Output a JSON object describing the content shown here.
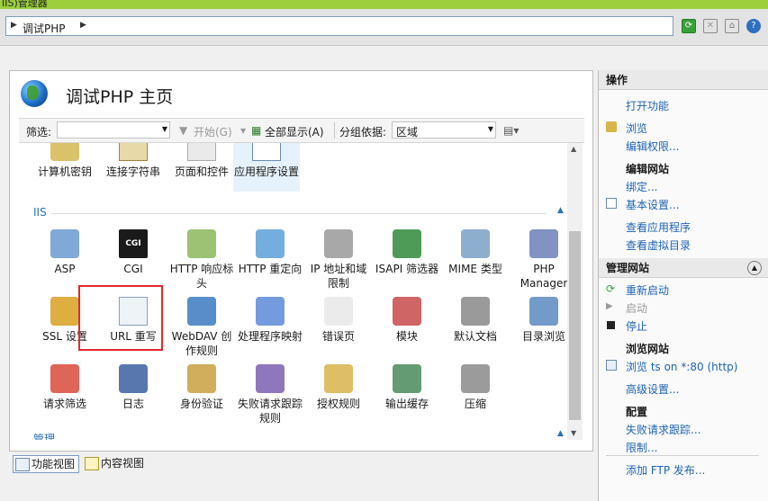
{
  "window": {
    "title": "IIS)管理器"
  },
  "address": {
    "crumb": "调试PHP"
  },
  "page": {
    "title": "调试PHP 主页"
  },
  "filter": {
    "label": "筛选:",
    "start_label": "开始(G)",
    "show_all_label": "全部显示(A)",
    "group_label": "分组依据:",
    "group_value": "区域"
  },
  "top_row": [
    "计算机密钥",
    "连接字符串",
    "页面和控件",
    "应用程序设置"
  ],
  "sections": {
    "iis": "IIS",
    "manage": "管理"
  },
  "iis_items": [
    {
      "label": "ASP",
      "icon": "asp-icon"
    },
    {
      "label": "CGI",
      "icon": "cgi-icon"
    },
    {
      "label": "HTTP 响应标头",
      "icon": "http-response-headers-icon"
    },
    {
      "label": "HTTP 重定向",
      "icon": "http-redirect-icon"
    },
    {
      "label": "IP 地址和域限制",
      "icon": "ip-restrictions-icon"
    },
    {
      "label": "ISAPI 筛选器",
      "icon": "isapi-filters-icon"
    },
    {
      "label": "MIME 类型",
      "icon": "mime-types-icon"
    },
    {
      "label": "PHP Manager",
      "icon": "php-manager-icon"
    },
    {
      "label": "SSL 设置",
      "icon": "ssl-lock-icon"
    },
    {
      "label": "URL 重写",
      "icon": "url-rewrite-icon"
    },
    {
      "label": "WebDAV 创作规则",
      "icon": "webdav-icon"
    },
    {
      "label": "处理程序映射",
      "icon": "handler-mappings-icon"
    },
    {
      "label": "错误页",
      "icon": "error-pages-icon"
    },
    {
      "label": "模块",
      "icon": "modules-icon"
    },
    {
      "label": "默认文档",
      "icon": "default-document-icon"
    },
    {
      "label": "目录浏览",
      "icon": "directory-browsing-icon"
    },
    {
      "label": "请求筛选",
      "icon": "request-filtering-icon"
    },
    {
      "label": "日志",
      "icon": "logging-icon"
    },
    {
      "label": "身份验证",
      "icon": "authentication-icon"
    },
    {
      "label": "失败请求跟踪规则",
      "icon": "failed-request-tracing-icon"
    },
    {
      "label": "授权规则",
      "icon": "authorization-rules-icon"
    },
    {
      "label": "输出缓存",
      "icon": "output-caching-icon"
    },
    {
      "label": "压缩",
      "icon": "compression-icon"
    }
  ],
  "tabs": {
    "features": "功能视图",
    "content": "内容视图"
  },
  "actions": {
    "header": "操作",
    "open_feature": "打开功能",
    "explore": "浏览",
    "edit_permissions": "编辑权限...",
    "edit_site": "编辑网站",
    "bindings": "绑定...",
    "basic_settings": "基本设置...",
    "view_applications": "查看应用程序",
    "view_vdirs": "查看虚拟目录",
    "manage_site": "管理网站",
    "restart": "重新启动",
    "start": "启动",
    "stop": "停止",
    "browse_site": "浏览网站",
    "browse_port": "浏览 ts on *:80 (http)",
    "advanced_settings": "高级设置...",
    "configure": "配置",
    "failed_request_tracing": "失败请求跟踪...",
    "limits": "限制...",
    "add_ftp": "添加 FTP 发布..."
  },
  "colors": {
    "accent": "#2a6fb6",
    "titlebar": "#9bcf3c",
    "highlight": "#e02a2a"
  }
}
